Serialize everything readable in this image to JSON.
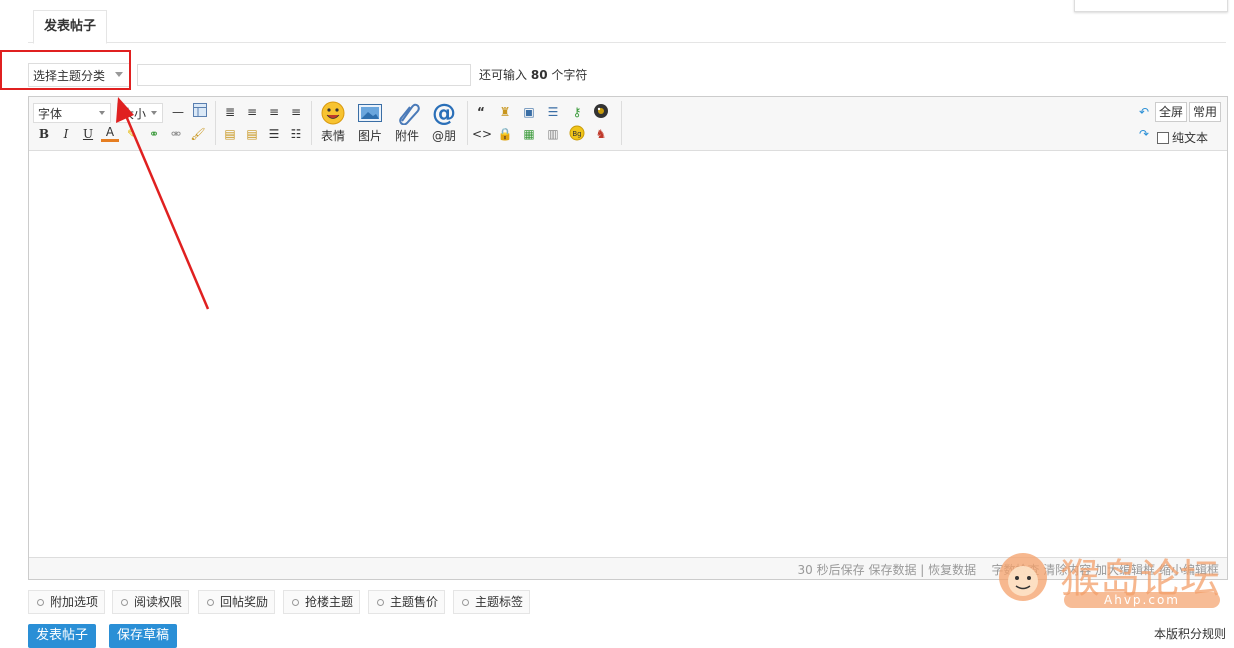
{
  "tabs": {
    "post_tab": "发表帖子"
  },
  "subject": {
    "type_select": "选择主题分类",
    "title_value": "",
    "remain_prefix": "还可输入",
    "remain_count": "80",
    "remain_suffix": "个字符"
  },
  "toolbar": {
    "font_select": "字体",
    "size_select": "大小",
    "bold": "B",
    "italic": "I",
    "underline": "U",
    "font_color": "A",
    "emoticon": "表情",
    "image": "图片",
    "attachment": "附件",
    "at": "@朋",
    "quote": "“",
    "code": "<>",
    "fullscreen": "全屏",
    "common": "常用",
    "plaintext": "纯文本"
  },
  "status": {
    "autosave": "30 秒后保存",
    "save_data": "保存数据",
    "divider": "|",
    "restore": "恢复数据",
    "word_check": "字数检查",
    "clear": "清除内容",
    "enlarge": "加大编辑框",
    "shrink": "缩小编辑框"
  },
  "options": [
    "附加选项",
    "阅读权限",
    "回帖奖励",
    "抢楼主题",
    "主题售价",
    "主题标签"
  ],
  "actions": {
    "submit": "发表帖子",
    "save_draft": "保存草稿",
    "rules": "本版积分规则"
  },
  "watermark": {
    "brand": "猴岛论坛",
    "url": "Ahvp.com"
  },
  "colors": {
    "accent_blue": "#2a8fd6",
    "highlight_red": "#e02020",
    "watermark_orange": "#f4a06a"
  }
}
